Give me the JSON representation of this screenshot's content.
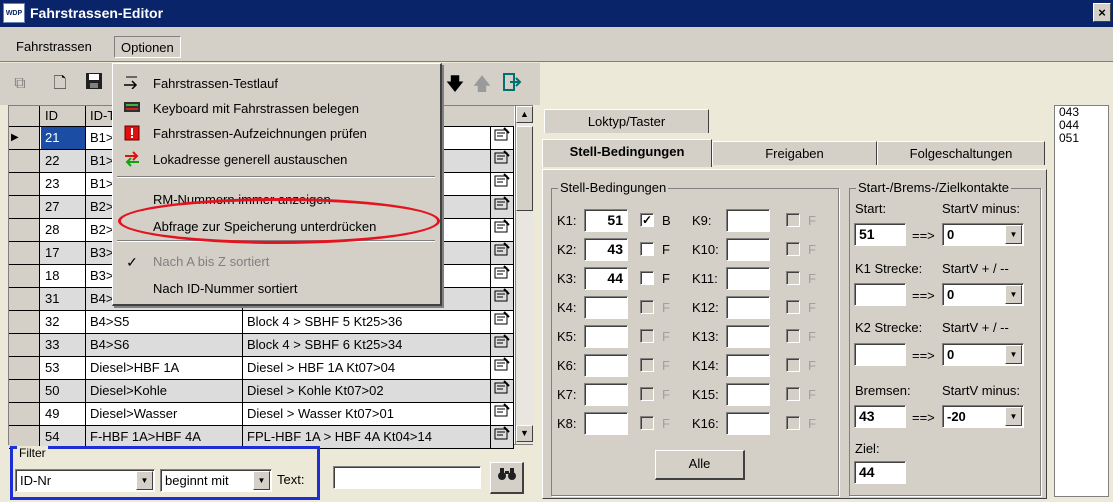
{
  "window": {
    "title": "Fahrstrassen-Editor",
    "logo_text": "WDP",
    "close_glyph": "×"
  },
  "menubar": {
    "items": [
      {
        "label": "Fahrstrassen"
      },
      {
        "label": "Optionen"
      }
    ]
  },
  "toolbar": {
    "icons": [
      "copy-icon",
      "new-document-icon",
      "save-icon",
      "move-down-icon",
      "move-up-icon",
      "exit-icon"
    ]
  },
  "options_menu": {
    "items": [
      {
        "label": "Fahrstrassen-Testlauf",
        "icon": "test-run-icon",
        "enabled": true
      },
      {
        "label": "Keyboard mit Fahrstrassen belegen",
        "icon": "keyboard-icon",
        "enabled": true
      },
      {
        "label": "Fahrstrassen-Aufzeichnungen prüfen",
        "icon": "warning-icon",
        "enabled": true
      },
      {
        "label": "Lokadresse generell austauschen",
        "icon": "swap-icon",
        "enabled": true
      },
      {
        "label": "RM-Nummern immer anzeigen",
        "icon": "",
        "enabled": true
      },
      {
        "label": "Abfrage zur Speicherung unterdrücken",
        "icon": "",
        "enabled": true,
        "highlighted": true
      },
      {
        "label": "Nach A bis Z sortiert",
        "icon": "checkmark-icon",
        "enabled": false,
        "checked": true
      },
      {
        "label": "Nach ID-Nummer sortiert",
        "icon": "",
        "enabled": true
      }
    ],
    "highlight_color": "#e3141f"
  },
  "grid": {
    "headers": [
      "ID",
      "ID-T"
    ],
    "rows": [
      {
        "id": "21",
        "idt": "B1>",
        "desc": "",
        "current": true
      },
      {
        "id": "22",
        "idt": "B1>",
        "desc": ""
      },
      {
        "id": "23",
        "idt": "B1>",
        "desc": ""
      },
      {
        "id": "27",
        "idt": "B2>",
        "desc": ""
      },
      {
        "id": "28",
        "idt": "B2>",
        "desc": ""
      },
      {
        "id": "17",
        "idt": "B3>",
        "desc": ""
      },
      {
        "id": "18",
        "idt": "B3>",
        "desc": ""
      },
      {
        "id": "31",
        "idt": "B4>",
        "desc": ""
      },
      {
        "id": "32",
        "idt": "B4>S5",
        "desc": "Block 4 > SBHF 5 Kt25>36"
      },
      {
        "id": "33",
        "idt": "B4>S6",
        "desc": "Block 4 > SBHF 6 Kt25>34"
      },
      {
        "id": "53",
        "idt": "Diesel>HBF 1A",
        "desc": "Diesel > HBF 1A Kt07>04"
      },
      {
        "id": "50",
        "idt": "Diesel>Kohle",
        "desc": "Diesel > Kohle Kt07>02"
      },
      {
        "id": "49",
        "idt": "Diesel>Wasser",
        "desc": "Diesel > Wasser Kt07>01"
      },
      {
        "id": "54",
        "idt": "F-HBF 1A>HBF 4A",
        "desc": "FPL-HBF 1A > HBF 4A Kt04>14"
      }
    ]
  },
  "filter": {
    "legend": "Filter",
    "field_value": "ID-Nr",
    "mode_value": "beginnt mit",
    "text_label": "Text:",
    "text_value": "",
    "highlight_color": "#1d2ed4"
  },
  "tabs": {
    "row1": [
      {
        "label": "Loktyp/Taster"
      }
    ],
    "row2": [
      {
        "label": "Stell-Bedingungen",
        "active": true
      },
      {
        "label": "Freigaben"
      },
      {
        "label": "Folgeschaltungen"
      }
    ]
  },
  "stell": {
    "group_label": "Stell-Bedingungen",
    "left": [
      {
        "label": "K1:",
        "value": "51",
        "checked": true,
        "flag": "B",
        "enabled": true
      },
      {
        "label": "K2:",
        "value": "43",
        "checked": false,
        "flag": "F",
        "enabled": true
      },
      {
        "label": "K3:",
        "value": "44",
        "checked": false,
        "flag": "F",
        "enabled": true
      },
      {
        "label": "K4:",
        "value": "",
        "checked": false,
        "flag": "F",
        "enabled": false
      },
      {
        "label": "K5:",
        "value": "",
        "checked": false,
        "flag": "F",
        "enabled": false
      },
      {
        "label": "K6:",
        "value": "",
        "checked": false,
        "flag": "F",
        "enabled": false
      },
      {
        "label": "K7:",
        "value": "",
        "checked": false,
        "flag": "F",
        "enabled": false
      },
      {
        "label": "K8:",
        "value": "",
        "checked": false,
        "flag": "F",
        "enabled": false
      }
    ],
    "right": [
      {
        "label": "K9:",
        "value": "",
        "flag": "F"
      },
      {
        "label": "K10:",
        "value": "",
        "flag": "F"
      },
      {
        "label": "K11:",
        "value": "",
        "flag": "F"
      },
      {
        "label": "K12:",
        "value": "",
        "flag": "F"
      },
      {
        "label": "K13:",
        "value": "",
        "flag": "F"
      },
      {
        "label": "K14:",
        "value": "",
        "flag": "F"
      },
      {
        "label": "K15:",
        "value": "",
        "flag": "F"
      },
      {
        "label": "K16:",
        "value": "",
        "flag": "F"
      }
    ],
    "all_button": "Alle"
  },
  "kontakte": {
    "group_label": "Start-/Brems-/Zielkontakte",
    "start_label": "Start:",
    "startv_minus_label": "StartV minus:",
    "start_value": "51",
    "arrow": "==>",
    "start_combo": "0",
    "k1_label": "K1 Strecke:",
    "startv_pm_label": "StartV + / --",
    "k1_value": "",
    "k1_combo": "0",
    "k2_label": "K2 Strecke:",
    "startv_pm_label2": "StartV + / --",
    "k2_value": "",
    "k2_combo": "0",
    "bremsen_label": "Bremsen:",
    "startv_minus_label2": "StartV minus:",
    "bremsen_value": "43",
    "bremsen_combo": "-20",
    "ziel_label": "Ziel:",
    "ziel_value": "44"
  },
  "side_list": {
    "items": [
      "043",
      "044",
      "051"
    ]
  }
}
